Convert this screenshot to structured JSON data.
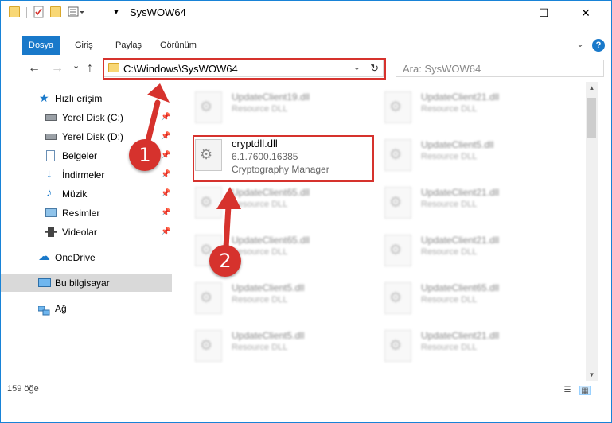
{
  "window": {
    "title": "SysWOW64",
    "minimize_glyph": "—",
    "maximize_glyph": "☐",
    "close_glyph": "✕"
  },
  "ribbon": {
    "tabs": [
      {
        "label": "Dosya",
        "active": true
      },
      {
        "label": "Giriş",
        "active": false
      },
      {
        "label": "Paylaş",
        "active": false
      },
      {
        "label": "Görünüm",
        "active": false
      }
    ],
    "help_glyph": "?",
    "collapse_glyph": "⌄"
  },
  "navigation": {
    "back_glyph": "←",
    "forward_glyph": "→",
    "recent_glyph": "⌄",
    "up_glyph": "↑",
    "address": "C:\\Windows\\SysWOW64",
    "address_dropdown_glyph": "⌄",
    "refresh_glyph": "↻",
    "search_placeholder": "Ara: SysWOW64"
  },
  "sidebar": {
    "items": [
      {
        "label": "Hızlı erişim",
        "icon": "star-icon",
        "pinned": false
      },
      {
        "label": "Yerel Disk (C:)",
        "icon": "drive-icon",
        "pinned": true
      },
      {
        "label": "Yerel Disk (D:)",
        "icon": "drive-icon",
        "pinned": true
      },
      {
        "label": "Belgeler",
        "icon": "documents-icon",
        "pinned": true
      },
      {
        "label": "İndirmeler",
        "icon": "downloads-icon",
        "pinned": true
      },
      {
        "label": "Müzik",
        "icon": "music-icon",
        "pinned": true
      },
      {
        "label": "Resimler",
        "icon": "pictures-icon",
        "pinned": true
      },
      {
        "label": "Videolar",
        "icon": "videos-icon",
        "pinned": true
      },
      {
        "label": "OneDrive",
        "icon": "cloud-icon",
        "pinned": false
      },
      {
        "label": "Bu bilgisayar",
        "icon": "computer-icon",
        "pinned": false
      },
      {
        "label": "Ağ",
        "icon": "network-icon",
        "pinned": false
      }
    ],
    "pin_glyph": "📌"
  },
  "files": {
    "focused": {
      "name": "cryptdll.dll",
      "version": "6.1.7600.16385",
      "description": "Cryptography Manager"
    },
    "left_column": [
      {
        "name": "UpdateClient19.dll",
        "type": "Resource DLL"
      },
      {
        "name": "UpdateClient65.dll",
        "type": "Resource DLL"
      },
      {
        "name": "UpdateClient65.dll",
        "type": "Resource DLL"
      },
      {
        "name": "UpdateClient5.dll",
        "type": "Resource DLL"
      },
      {
        "name": "UpdateClient5.dll",
        "type": "Resource DLL"
      }
    ],
    "right_column": [
      {
        "name": "UpdateClient21.dll",
        "type": "Resource DLL"
      },
      {
        "name": "UpdateClient5.dll",
        "type": "Resource DLL"
      },
      {
        "name": "UpdateClient21.dll",
        "type": "Resource DLL"
      },
      {
        "name": "UpdateClient21.dll",
        "type": "Resource DLL"
      },
      {
        "name": "UpdateClient65.dll",
        "type": "Resource DLL"
      },
      {
        "name": "UpdateClient21.dll",
        "type": "Resource DLL"
      }
    ]
  },
  "status": {
    "item_count": "159 öğe"
  },
  "callouts": [
    "1",
    "2"
  ],
  "colors": {
    "accent": "#1979ca",
    "highlight": "#d6322d"
  }
}
